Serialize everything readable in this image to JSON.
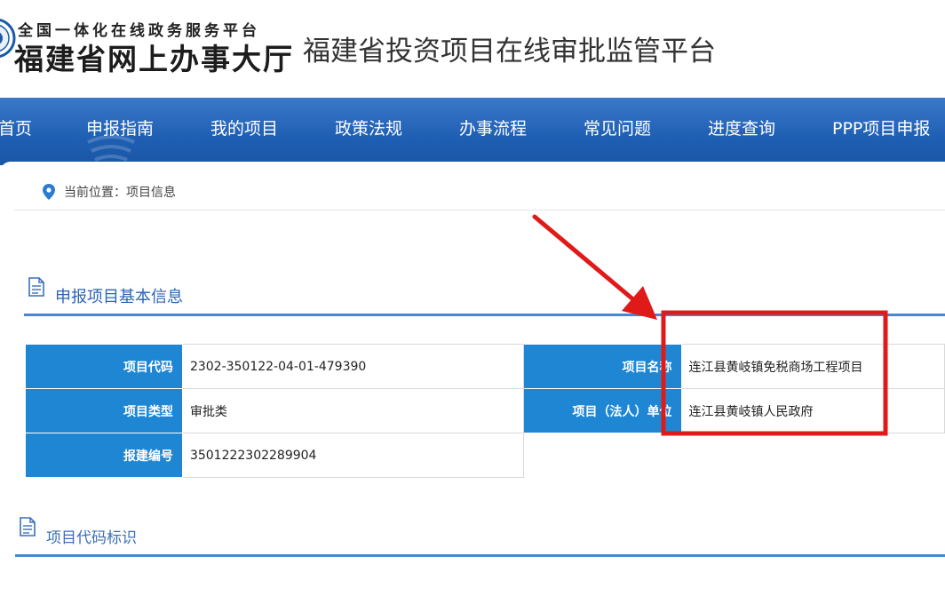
{
  "header": {
    "logo_line1": "全国一体化在线政务服务平台",
    "logo_line2": "福建省网上办事大厅",
    "platform_title": "福建省投资项目在线审批监管平台"
  },
  "nav": {
    "items": [
      "首页",
      "申报指南",
      "我的项目",
      "政策法规",
      "办事流程",
      "常见问题",
      "进度查询",
      "PPP项目申报"
    ]
  },
  "breadcrumb": {
    "text": "当前位置：项目信息"
  },
  "section_basic": {
    "title": "申报项目基本信息"
  },
  "table": {
    "rows": [
      {
        "label1": "项目代码",
        "value1": "2302-350122-04-01-479390",
        "label2": "项目名称",
        "value2": "连江县黄岐镇免税商场工程项目"
      },
      {
        "label1": "项目类型",
        "value1": "审批类",
        "label2": "项目（法人）单位",
        "value2": "连江县黄岐镇人民政府"
      },
      {
        "label1": "报建编号",
        "value1": "3501222302289904"
      }
    ]
  },
  "section_code": {
    "title": "项目代码标识"
  },
  "colors": {
    "nav_bg": "#1f5fb3",
    "label_bg": "#1f86d4",
    "section_title": "#2b64b6",
    "annotation_red": "#e01919"
  },
  "icons": {
    "location": "location-pin-icon",
    "document": "document-icon",
    "emblem": "emblem-logo"
  }
}
